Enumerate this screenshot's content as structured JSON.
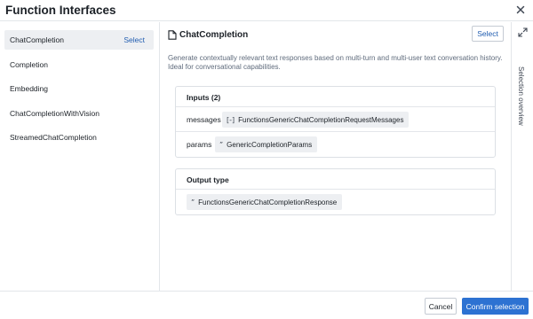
{
  "dialog": {
    "title": "Function Interfaces",
    "close_icon": "close-icon"
  },
  "sidebar": {
    "items": [
      {
        "label": "ChatCompletion",
        "selected": true,
        "action": "Select"
      },
      {
        "label": "Completion"
      },
      {
        "label": "Embedding"
      },
      {
        "label": "ChatCompletionWithVision"
      },
      {
        "label": "StreamedChatCompletion"
      }
    ]
  },
  "detail": {
    "icon": "document-icon",
    "title": "ChatCompletion",
    "select_label": "Select",
    "description": "Generate contextually relevant text responses based on multi-turn and multi-user text conversation history. Ideal for conversational capabilities.",
    "inputs": {
      "header": "Inputs (2)",
      "rows": [
        {
          "name": "messages",
          "glyph": "[-]",
          "type": "FunctionsGenericChatCompletionRequestMessages"
        },
        {
          "name": "params",
          "glyph": "”",
          "type": "GenericCompletionParams"
        }
      ]
    },
    "output": {
      "header": "Output type",
      "glyph": "”",
      "type": "FunctionsGenericChatCompletionResponse"
    }
  },
  "right_rail": {
    "expand_icon": "expand-icon",
    "label": "Selection overview"
  },
  "footer": {
    "cancel_label": "Cancel",
    "confirm_label": "Confirm selection"
  },
  "colors": {
    "accent": "#2d72d2",
    "link": "#215db0",
    "selected_bg": "#edeff2",
    "border": "#e3e6ea"
  }
}
